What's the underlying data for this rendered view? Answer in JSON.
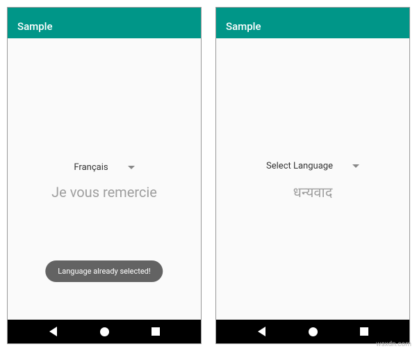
{
  "left": {
    "appbar_title": "Sample",
    "spinner_value": "Français",
    "message": "Je vous remercie",
    "toast": "Language already selected!"
  },
  "right": {
    "appbar_title": "Sample",
    "spinner_value": "Select Language",
    "message": "धन्यवाद"
  },
  "watermark": "wsxdn.com"
}
